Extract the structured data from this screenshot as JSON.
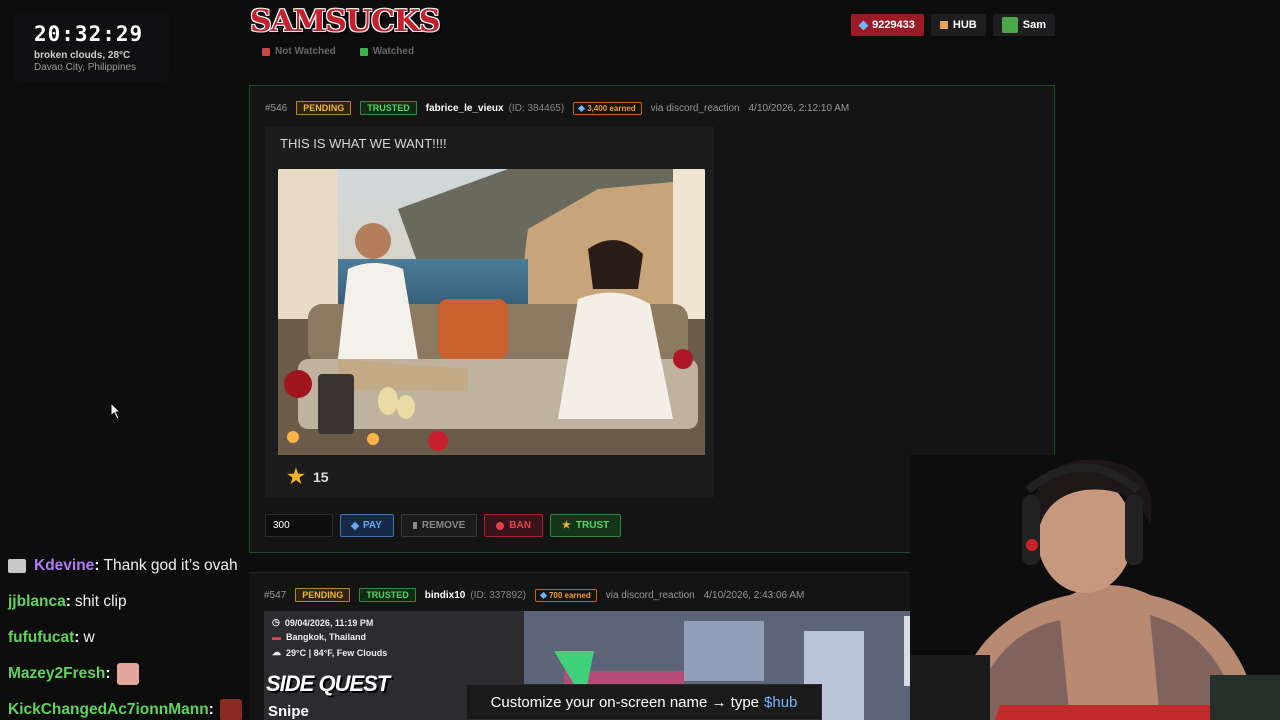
{
  "clock": {
    "time": "20:32:29",
    "weather": "broken clouds, 28°C",
    "location": "Davao City, Philippines"
  },
  "header": {
    "logo_text": "SAMSUCKS",
    "balance": "9229433",
    "hub_label": "HUB",
    "user_label": "Sam"
  },
  "filters": {
    "not_watched": "Not Watched",
    "watched": "Watched"
  },
  "submissions": [
    {
      "number": "#546",
      "status": "PENDING",
      "trust": "TRUSTED",
      "username": "fabrice_le_vieux",
      "user_id": "(ID: 384465)",
      "earned": "3,400 earned",
      "via": "via discord_reaction",
      "timestamp": "4/10/2026, 2:12:10 AM",
      "caption": "THIS IS WHAT WE WANT!!!!",
      "stars": "15",
      "amount": "300",
      "actions": {
        "pay": "PAY",
        "remove": "REMOVE",
        "ban": "BAN",
        "trust": "TRUST"
      }
    },
    {
      "number": "#547",
      "status": "PENDING",
      "trust": "TRUSTED",
      "username": "bindix10",
      "user_id": "(ID: 337892)",
      "earned": "700 earned",
      "via": "via discord_reaction",
      "timestamp": "4/10/2026, 2:43:06 AM",
      "overlay": {
        "date": "09/04/2026, 11:19 PM",
        "place": "Bangkok, Thailand",
        "weather": "29°C | 84°F, Few Clouds",
        "title": "SIDE QUEST",
        "subtitle": "Snipe"
      }
    }
  ],
  "chat": [
    {
      "user": "Kdevine",
      "color": "#b07cf5",
      "text": "Thank god it’s ovah",
      "icon": "chat-badge-icon"
    },
    {
      "user": "jjblanca",
      "color": "#5fd35a",
      "text": "shit clip"
    },
    {
      "user": "fufufucat",
      "color": "#5fd35a",
      "text": "w"
    },
    {
      "user": "Mazey2Fresh",
      "color": "#5fd35a",
      "text": "",
      "emote": "face-emote"
    },
    {
      "user": "KickChangedAc7ionnMann",
      "color": "#5fd35a",
      "text": "",
      "emote": "face-emote"
    }
  ],
  "toast": {
    "prefix": "Customize your on-screen name → type",
    "command": "$hub"
  },
  "colors": {
    "accent_red": "#c3212b",
    "pending": "#f2b52a",
    "trusted": "#4fd66a",
    "earned": "#f39a2a",
    "pay": "#68a8ee",
    "ban": "#e5424f"
  }
}
